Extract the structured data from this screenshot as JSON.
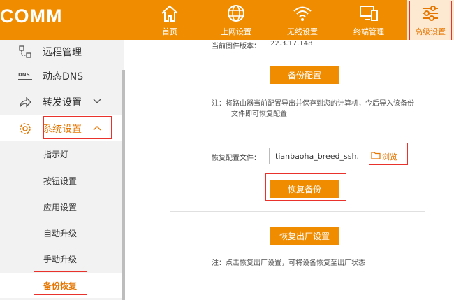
{
  "header": {
    "brand": "COMM",
    "nav": [
      {
        "label": "首页",
        "icon": "home-icon"
      },
      {
        "label": "上网设置",
        "icon": "globe-icon"
      },
      {
        "label": "无线设置",
        "icon": "wifi-icon"
      },
      {
        "label": "终端管理",
        "icon": "devices-icon"
      },
      {
        "label": "高级设置",
        "icon": "sliders-icon"
      }
    ]
  },
  "sidebar": {
    "items": [
      {
        "label": "远程管理",
        "icon": "remote-icon"
      },
      {
        "label": "动态DNS",
        "icon": "dns-icon"
      },
      {
        "label": "转发设置",
        "icon": "forward-icon"
      },
      {
        "label": "系统设置",
        "icon": "gear-icon"
      }
    ],
    "dns_icon_text": "DNS",
    "sub_items": [
      "指示灯",
      "按钮设置",
      "应用设置",
      "自动升级",
      "手动升级",
      "备份恢复"
    ]
  },
  "main": {
    "firmware_label": "当前固件版本：",
    "firmware_value": "22.3.17.148",
    "backup_button": "备份配置",
    "backup_note_line1": "注：将路由器当前配置导出并保存到您的计算机，今后导入该备份",
    "backup_note_line2": "文件即可恢复配置",
    "restore_file_label": "恢复配置文件：",
    "restore_file_value": "tianbaoha_breed_ssh.dat",
    "browse_label": "浏览",
    "restore_button": "恢复备份",
    "factory_button": "恢复出厂设置",
    "factory_note": "注：点击恢复出厂设置，可将设备恢复至出厂状态"
  },
  "colors": {
    "accent": "#f08c00",
    "highlight_box": "#e8322b",
    "sidebar_bg": "#f2f2f2"
  }
}
